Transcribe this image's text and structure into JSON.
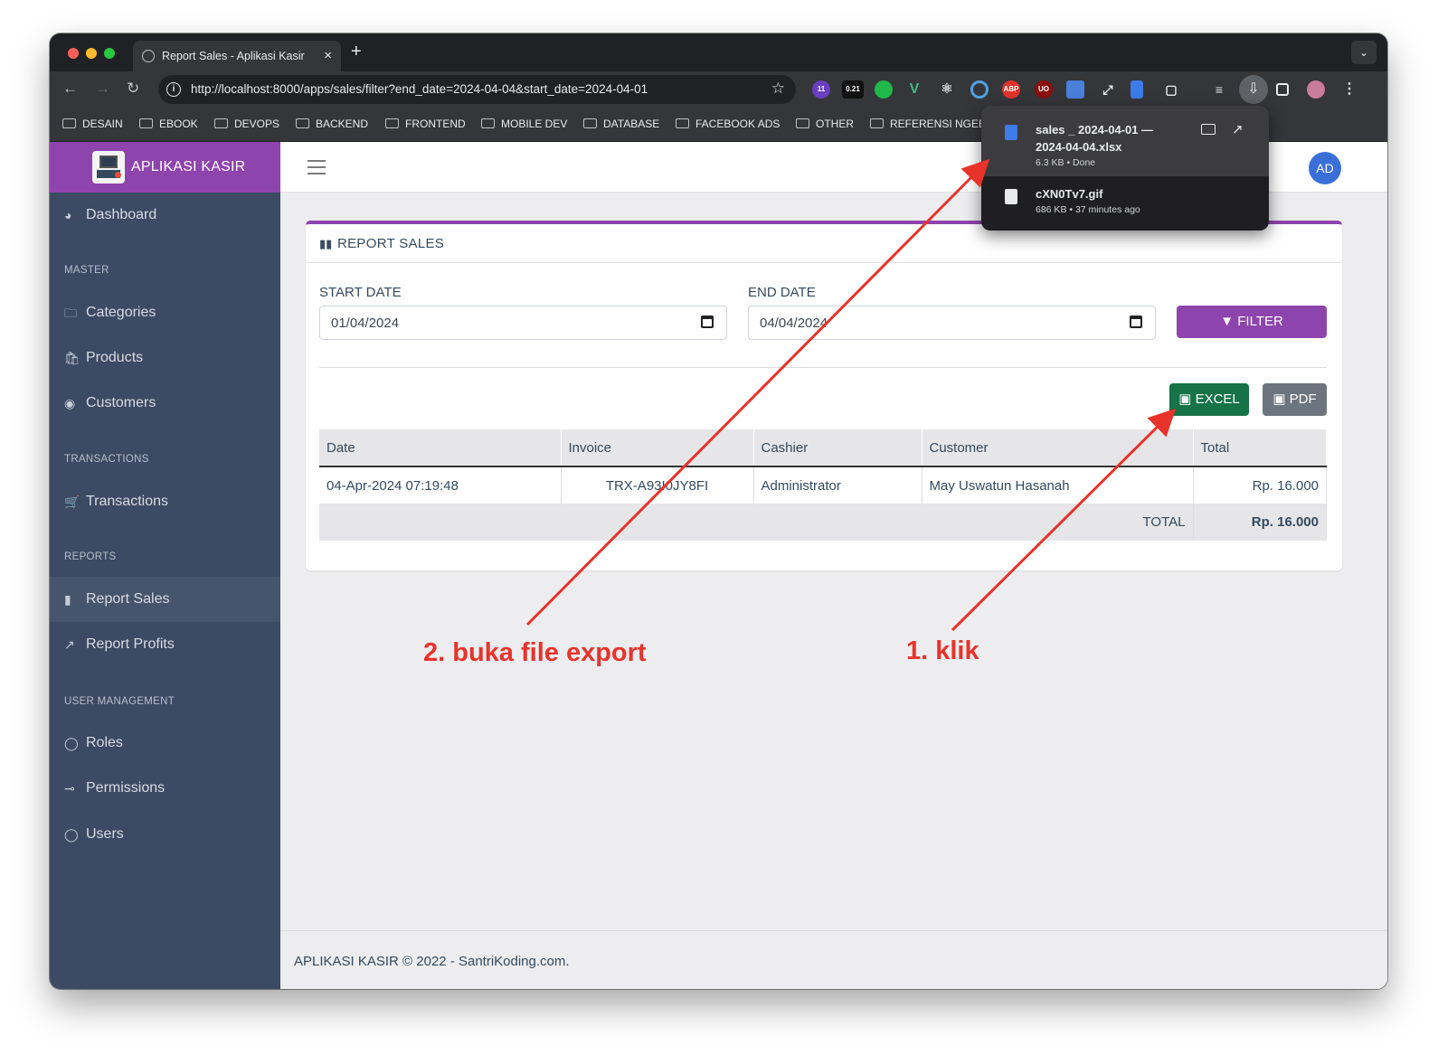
{
  "browser": {
    "tab_title": "Report Sales - Aplikasi Kasir",
    "tab_close": "×",
    "new_tab": "+",
    "tab_menu": "⌄",
    "url": "http://localhost:8000/apps/sales/filter?end_date=2024-04-04&start_date=2024-04-01",
    "ext_badge_1": "11",
    "ext_badge_2": "0.21",
    "ext_abp": "ABP",
    "ext_ub": "UO",
    "bookmarks": [
      "DESAIN",
      "EBOOK",
      "DEVOPS",
      "BACKEND",
      "FRONTEND",
      "MOBILE DEV",
      "DATABASE",
      "FACEBOOK ADS",
      "OTHER",
      "REFERENSI NGEB"
    ],
    "colors": {
      "close": "#ff5f57",
      "minimize": "#febc2e",
      "maximize": "#28c840"
    }
  },
  "downloads": [
    {
      "name_line1": "sales _ 2024-04-01 —",
      "name_line2": "2024-04-04.xlsx",
      "meta": "6.3 KB • Done"
    },
    {
      "name_line1": "cXN0Tv7.gif",
      "meta": "686 KB • 37 minutes ago"
    }
  ],
  "app": {
    "brand": "APLIKASI KASIR",
    "avatar": "AD",
    "accent": "#8e44ad",
    "sidebar": {
      "dashboard": "Dashboard",
      "master_head": "MASTER",
      "categories": "Categories",
      "products": "Products",
      "customers": "Customers",
      "transactions_head": "TRANSACTIONS",
      "transactions": "Transactions",
      "reports_head": "REPORTS",
      "report_sales": "Report Sales",
      "report_profits": "Report Profits",
      "user_head": "USER MANAGEMENT",
      "roles": "Roles",
      "permissions": "Permissions",
      "users": "Users"
    },
    "card": {
      "title": "REPORT SALES",
      "start_label": "START DATE",
      "start_value": "01/04/2024",
      "end_label": "END DATE",
      "end_value": "04/04/2024",
      "filter_btn": "FILTER",
      "excel_btn": "EXCEL",
      "pdf_btn": "PDF"
    },
    "table": {
      "headers": [
        "Date",
        "Invoice",
        "Cashier",
        "Customer",
        "Total"
      ],
      "rows": [
        [
          "04-Apr-2024 07:19:48",
          "TRX-A93I0JY8FI",
          "Administrator",
          "May Uswatun Hasanah",
          "Rp. 16.000"
        ]
      ],
      "total_label": "TOTAL",
      "total_value": "Rp. 16.000"
    },
    "footer": {
      "brand": "APLIKASI KASIR",
      "rest": " © 2022 - SantriKoding.com."
    }
  },
  "annotations": {
    "open_file": "2. buka file export",
    "click": "1. klik",
    "color": "#e8332a"
  }
}
